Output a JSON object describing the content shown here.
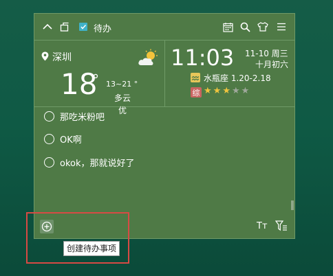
{
  "toolbar": {
    "title": "待办",
    "icons": [
      "chevron-up-icon",
      "popout-icon",
      "todo-icon",
      "calendar-icon",
      "search-icon",
      "shirt-icon",
      "menu-icon"
    ]
  },
  "weather": {
    "city": "深圳",
    "temperature": "18",
    "degree": "°",
    "range": "13~21 °",
    "condition": "多云",
    "air_quality": "优"
  },
  "time": {
    "clock": "11:03",
    "date": "11-10 周三",
    "lunar": "十月初六"
  },
  "zodiac": {
    "label": "水瓶座  1.20-2.18",
    "comprehensive_badge": "综",
    "stars_on": 3,
    "stars_total": 5
  },
  "todos": [
    {
      "text": "那吃米粉吧"
    },
    {
      "text": "OK啊"
    },
    {
      "text": "okok，那就说好了"
    }
  ],
  "bottom_bar": {
    "add_icon": "plus-circle-icon",
    "font_icon_label": "Tт",
    "filter_icon": "filter-list-icon"
  },
  "tooltip": {
    "text": "创建待办事项"
  },
  "colors": {
    "widget_bg": "#4f7a46",
    "highlight": "#d84a44",
    "star_on": "#f0c43e"
  }
}
